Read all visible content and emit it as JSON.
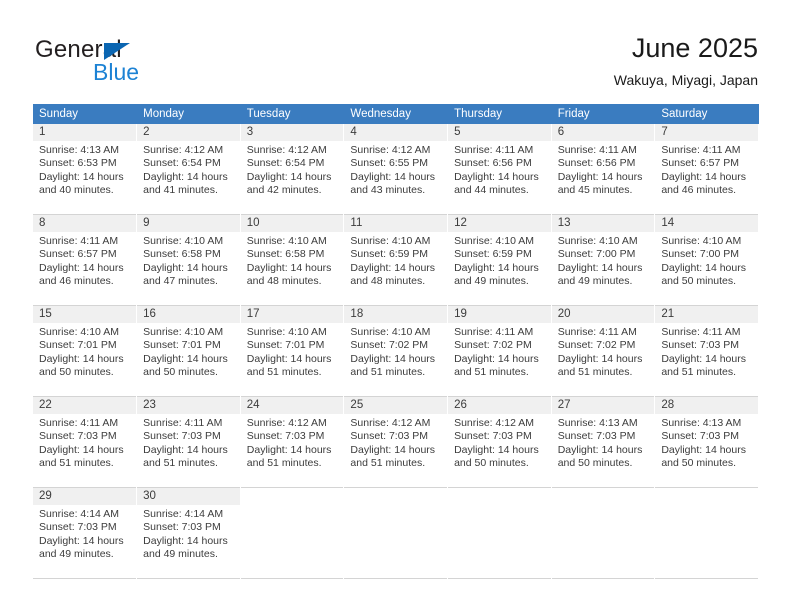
{
  "logo": {
    "text_primary": "General",
    "text_secondary": "Blue",
    "primary_color": "#231f20",
    "secondary_color": "#1c82d4",
    "triangle_color": "#0b66b2"
  },
  "header": {
    "title": "June 2025",
    "subtitle": "Wakuya, Miyagi, Japan"
  },
  "theme": {
    "header_row_bg": "#3a7cc0",
    "daynum_bg": "#f0f0f0",
    "grid_line": "#d4d4d4",
    "text": "#3c3c3c"
  },
  "columns": [
    "Sunday",
    "Monday",
    "Tuesday",
    "Wednesday",
    "Thursday",
    "Friday",
    "Saturday"
  ],
  "weeks": [
    [
      {
        "day": "1",
        "sunrise": "Sunrise: 4:13 AM",
        "sunset": "Sunset: 6:53 PM",
        "daylight": "Daylight: 14 hours and 40 minutes."
      },
      {
        "day": "2",
        "sunrise": "Sunrise: 4:12 AM",
        "sunset": "Sunset: 6:54 PM",
        "daylight": "Daylight: 14 hours and 41 minutes."
      },
      {
        "day": "3",
        "sunrise": "Sunrise: 4:12 AM",
        "sunset": "Sunset: 6:54 PM",
        "daylight": "Daylight: 14 hours and 42 minutes."
      },
      {
        "day": "4",
        "sunrise": "Sunrise: 4:12 AM",
        "sunset": "Sunset: 6:55 PM",
        "daylight": "Daylight: 14 hours and 43 minutes."
      },
      {
        "day": "5",
        "sunrise": "Sunrise: 4:11 AM",
        "sunset": "Sunset: 6:56 PM",
        "daylight": "Daylight: 14 hours and 44 minutes."
      },
      {
        "day": "6",
        "sunrise": "Sunrise: 4:11 AM",
        "sunset": "Sunset: 6:56 PM",
        "daylight": "Daylight: 14 hours and 45 minutes."
      },
      {
        "day": "7",
        "sunrise": "Sunrise: 4:11 AM",
        "sunset": "Sunset: 6:57 PM",
        "daylight": "Daylight: 14 hours and 46 minutes."
      }
    ],
    [
      {
        "day": "8",
        "sunrise": "Sunrise: 4:11 AM",
        "sunset": "Sunset: 6:57 PM",
        "daylight": "Daylight: 14 hours and 46 minutes."
      },
      {
        "day": "9",
        "sunrise": "Sunrise: 4:10 AM",
        "sunset": "Sunset: 6:58 PM",
        "daylight": "Daylight: 14 hours and 47 minutes."
      },
      {
        "day": "10",
        "sunrise": "Sunrise: 4:10 AM",
        "sunset": "Sunset: 6:58 PM",
        "daylight": "Daylight: 14 hours and 48 minutes."
      },
      {
        "day": "11",
        "sunrise": "Sunrise: 4:10 AM",
        "sunset": "Sunset: 6:59 PM",
        "daylight": "Daylight: 14 hours and 48 minutes."
      },
      {
        "day": "12",
        "sunrise": "Sunrise: 4:10 AM",
        "sunset": "Sunset: 6:59 PM",
        "daylight": "Daylight: 14 hours and 49 minutes."
      },
      {
        "day": "13",
        "sunrise": "Sunrise: 4:10 AM",
        "sunset": "Sunset: 7:00 PM",
        "daylight": "Daylight: 14 hours and 49 minutes."
      },
      {
        "day": "14",
        "sunrise": "Sunrise: 4:10 AM",
        "sunset": "Sunset: 7:00 PM",
        "daylight": "Daylight: 14 hours and 50 minutes."
      }
    ],
    [
      {
        "day": "15",
        "sunrise": "Sunrise: 4:10 AM",
        "sunset": "Sunset: 7:01 PM",
        "daylight": "Daylight: 14 hours and 50 minutes."
      },
      {
        "day": "16",
        "sunrise": "Sunrise: 4:10 AM",
        "sunset": "Sunset: 7:01 PM",
        "daylight": "Daylight: 14 hours and 50 minutes."
      },
      {
        "day": "17",
        "sunrise": "Sunrise: 4:10 AM",
        "sunset": "Sunset: 7:01 PM",
        "daylight": "Daylight: 14 hours and 51 minutes."
      },
      {
        "day": "18",
        "sunrise": "Sunrise: 4:10 AM",
        "sunset": "Sunset: 7:02 PM",
        "daylight": "Daylight: 14 hours and 51 minutes."
      },
      {
        "day": "19",
        "sunrise": "Sunrise: 4:11 AM",
        "sunset": "Sunset: 7:02 PM",
        "daylight": "Daylight: 14 hours and 51 minutes."
      },
      {
        "day": "20",
        "sunrise": "Sunrise: 4:11 AM",
        "sunset": "Sunset: 7:02 PM",
        "daylight": "Daylight: 14 hours and 51 minutes."
      },
      {
        "day": "21",
        "sunrise": "Sunrise: 4:11 AM",
        "sunset": "Sunset: 7:03 PM",
        "daylight": "Daylight: 14 hours and 51 minutes."
      }
    ],
    [
      {
        "day": "22",
        "sunrise": "Sunrise: 4:11 AM",
        "sunset": "Sunset: 7:03 PM",
        "daylight": "Daylight: 14 hours and 51 minutes."
      },
      {
        "day": "23",
        "sunrise": "Sunrise: 4:11 AM",
        "sunset": "Sunset: 7:03 PM",
        "daylight": "Daylight: 14 hours and 51 minutes."
      },
      {
        "day": "24",
        "sunrise": "Sunrise: 4:12 AM",
        "sunset": "Sunset: 7:03 PM",
        "daylight": "Daylight: 14 hours and 51 minutes."
      },
      {
        "day": "25",
        "sunrise": "Sunrise: 4:12 AM",
        "sunset": "Sunset: 7:03 PM",
        "daylight": "Daylight: 14 hours and 51 minutes."
      },
      {
        "day": "26",
        "sunrise": "Sunrise: 4:12 AM",
        "sunset": "Sunset: 7:03 PM",
        "daylight": "Daylight: 14 hours and 50 minutes."
      },
      {
        "day": "27",
        "sunrise": "Sunrise: 4:13 AM",
        "sunset": "Sunset: 7:03 PM",
        "daylight": "Daylight: 14 hours and 50 minutes."
      },
      {
        "day": "28",
        "sunrise": "Sunrise: 4:13 AM",
        "sunset": "Sunset: 7:03 PM",
        "daylight": "Daylight: 14 hours and 50 minutes."
      }
    ],
    [
      {
        "day": "29",
        "sunrise": "Sunrise: 4:14 AM",
        "sunset": "Sunset: 7:03 PM",
        "daylight": "Daylight: 14 hours and 49 minutes."
      },
      {
        "day": "30",
        "sunrise": "Sunrise: 4:14 AM",
        "sunset": "Sunset: 7:03 PM",
        "daylight": "Daylight: 14 hours and 49 minutes."
      },
      {
        "day": "",
        "sunrise": "",
        "sunset": "",
        "daylight": ""
      },
      {
        "day": "",
        "sunrise": "",
        "sunset": "",
        "daylight": ""
      },
      {
        "day": "",
        "sunrise": "",
        "sunset": "",
        "daylight": ""
      },
      {
        "day": "",
        "sunrise": "",
        "sunset": "",
        "daylight": ""
      },
      {
        "day": "",
        "sunrise": "",
        "sunset": "",
        "daylight": ""
      }
    ]
  ]
}
